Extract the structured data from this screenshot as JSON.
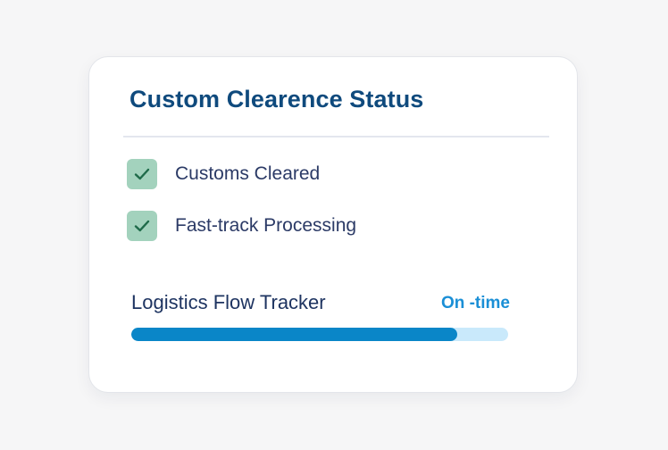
{
  "card": {
    "title": "Custom Clearence Status",
    "checks": [
      {
        "label": "Customs Cleared",
        "checked": true
      },
      {
        "label": "Fast-track Processing",
        "checked": true
      }
    ]
  },
  "tracker": {
    "label": "Logistics Flow Tracker",
    "status": "On -time",
    "progress": 0.865
  },
  "colors": {
    "title": "#0f4a7d",
    "check_bg": "#a3d2bd",
    "check_mark": "#1f6b4a",
    "progress_fill": "#0a86c8",
    "progress_track": "#c9e9fb",
    "status": "#1a8fd6"
  },
  "icons": {
    "check": "checkmark-icon"
  }
}
